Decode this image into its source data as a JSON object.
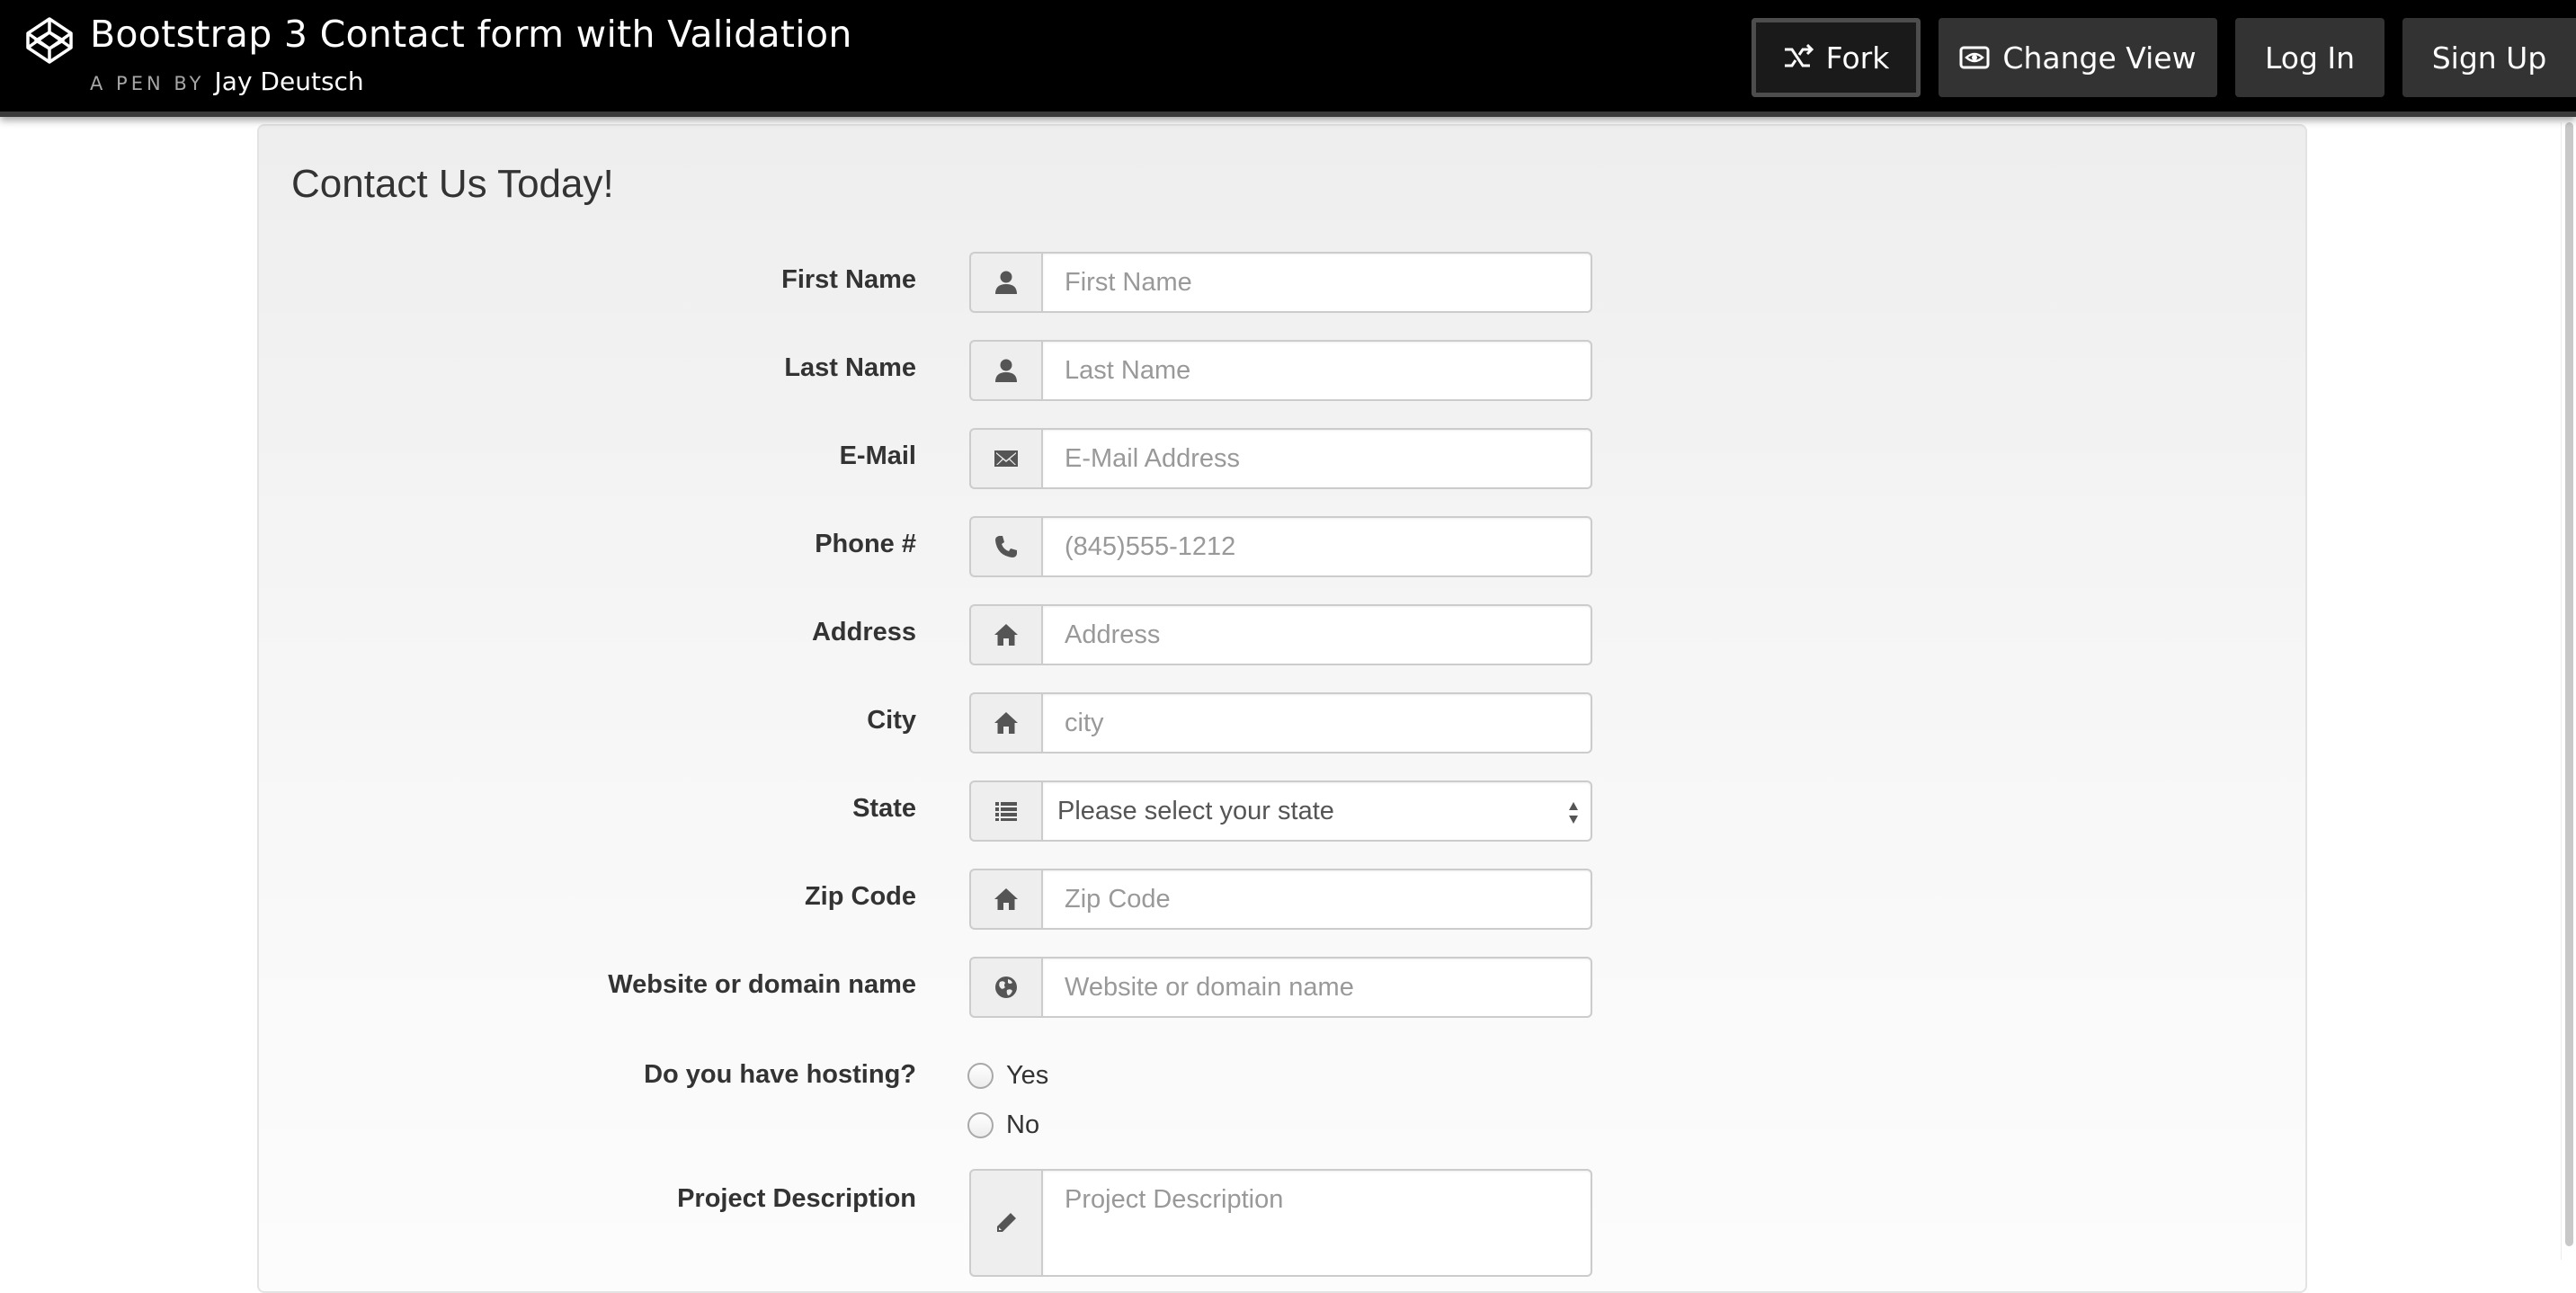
{
  "header": {
    "title": "Bootstrap 3 Contact form with Validation",
    "byline_prefix": "A PEN BY",
    "author": "Jay Deutsch",
    "logo_icon": "codepen-logo-icon",
    "buttons": {
      "fork": "Fork",
      "change_view": "Change View",
      "log_in": "Log In",
      "sign_up": "Sign Up"
    }
  },
  "form": {
    "legend": "Contact Us Today!",
    "fields": {
      "first_name": {
        "label": "First Name",
        "placeholder": "First Name",
        "icon": "user-icon"
      },
      "last_name": {
        "label": "Last Name",
        "placeholder": "Last Name",
        "icon": "user-icon"
      },
      "email": {
        "label": "E-Mail",
        "placeholder": "E-Mail Address",
        "icon": "envelope-icon"
      },
      "phone": {
        "label": "Phone #",
        "placeholder": "(845)555-1212",
        "icon": "phone-icon"
      },
      "address": {
        "label": "Address",
        "placeholder": "Address",
        "icon": "home-icon"
      },
      "city": {
        "label": "City",
        "placeholder": "city",
        "icon": "home-icon"
      },
      "state": {
        "label": "State",
        "selected": "Please select your state",
        "icon": "list-icon"
      },
      "zip": {
        "label": "Zip Code",
        "placeholder": "Zip Code",
        "icon": "home-icon"
      },
      "website": {
        "label": "Website or domain name",
        "placeholder": "Website or domain name",
        "icon": "globe-icon"
      },
      "hosting": {
        "label": "Do you have hosting?",
        "options": [
          "Yes",
          "No"
        ]
      },
      "description": {
        "label": "Project Description",
        "placeholder": "Project Description",
        "icon": "pencil-icon"
      }
    }
  }
}
